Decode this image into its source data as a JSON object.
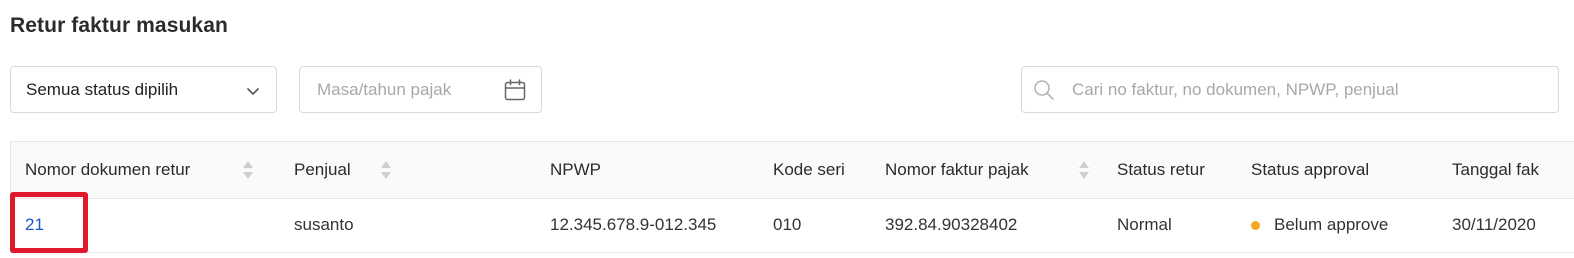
{
  "page": {
    "title": "Retur faktur masukan"
  },
  "filters": {
    "status_select_value": "Semua status dipilih",
    "period_placeholder": "Masa/tahun pajak",
    "search_placeholder": "Cari no faktur, no dokumen, NPWP, penjual"
  },
  "table": {
    "columns": [
      {
        "label": "Nomor dokumen retur",
        "sortable": true
      },
      {
        "label": "Penjual",
        "sortable": true
      },
      {
        "label": "NPWP",
        "sortable": false
      },
      {
        "label": "Kode seri",
        "sortable": false
      },
      {
        "label": "Nomor faktur pajak",
        "sortable": true
      },
      {
        "label": "Status retur",
        "sortable": false
      },
      {
        "label": "Status approval",
        "sortable": false
      },
      {
        "label": "Tanggal fak",
        "sortable": false
      }
    ],
    "rows": [
      {
        "nomor_dokumen_retur": "21",
        "penjual": "susanto",
        "npwp": "12.345.678.9-012.345",
        "kode_seri": "010",
        "nomor_faktur_pajak": "392.84.90328402",
        "status_retur": "Normal",
        "status_approval": "Belum approve",
        "status_approval_color": "#f5a623",
        "tanggal_faktur": "30/11/2020"
      }
    ]
  },
  "colors": {
    "link": "#1a56c8",
    "highlight": "#e0182b",
    "pending": "#f5a623"
  },
  "icons": {
    "select": "chevron-down-icon",
    "period": "calendar-icon",
    "search": "search-icon",
    "sort": "sort-icon"
  }
}
